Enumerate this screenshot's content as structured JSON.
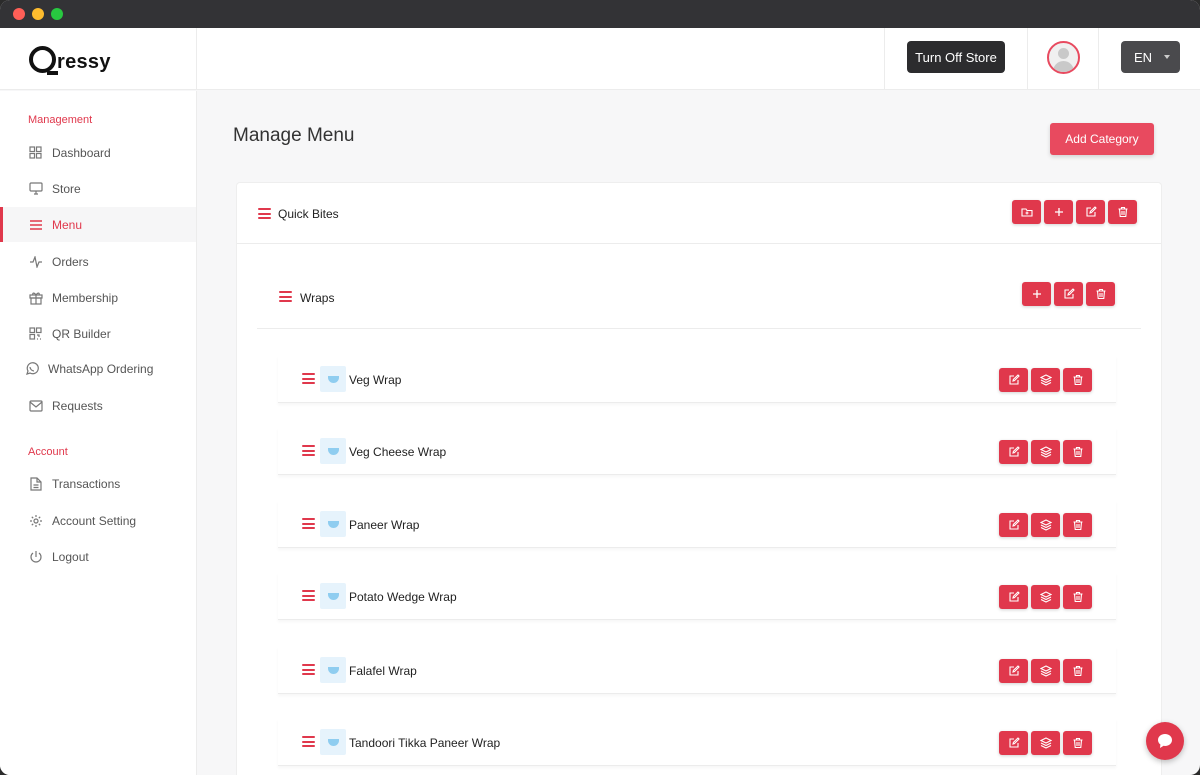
{
  "app": {
    "logo_text": "ressy"
  },
  "topbar": {
    "store_button": "Turn Off Store",
    "language": "EN"
  },
  "sidebar": {
    "management_heading": "Management",
    "management_items": [
      {
        "label": "Dashboard",
        "icon": "grid-icon"
      },
      {
        "label": "Store",
        "icon": "monitor-icon"
      },
      {
        "label": "Menu",
        "icon": "menu-icon",
        "active": true
      },
      {
        "label": "Orders",
        "icon": "activity-icon"
      },
      {
        "label": "Membership",
        "icon": "gift-icon"
      },
      {
        "label": "QR Builder",
        "icon": "qr-icon"
      },
      {
        "label": "WhatsApp Ordering",
        "icon": "whatsapp-icon"
      },
      {
        "label": "Requests",
        "icon": "mail-icon"
      }
    ],
    "account_heading": "Account",
    "account_items": [
      {
        "label": "Transactions",
        "icon": "file-icon"
      },
      {
        "label": "Account Setting",
        "icon": "gear-icon"
      },
      {
        "label": "Logout",
        "icon": "power-icon"
      }
    ]
  },
  "main": {
    "title": "Manage Menu",
    "add_category_label": "Add Category",
    "category": {
      "name": "Quick Bites"
    },
    "subcategory": {
      "name": "Wraps"
    },
    "items": [
      "Veg Wrap",
      "Veg Cheese Wrap",
      "Paneer Wrap",
      "Potato Wedge Wrap",
      "Falafel Wrap",
      "Tandoori Tikka Paneer Wrap"
    ]
  },
  "colors": {
    "accent": "#e0384c",
    "dark_button": "#2c2c2e"
  }
}
